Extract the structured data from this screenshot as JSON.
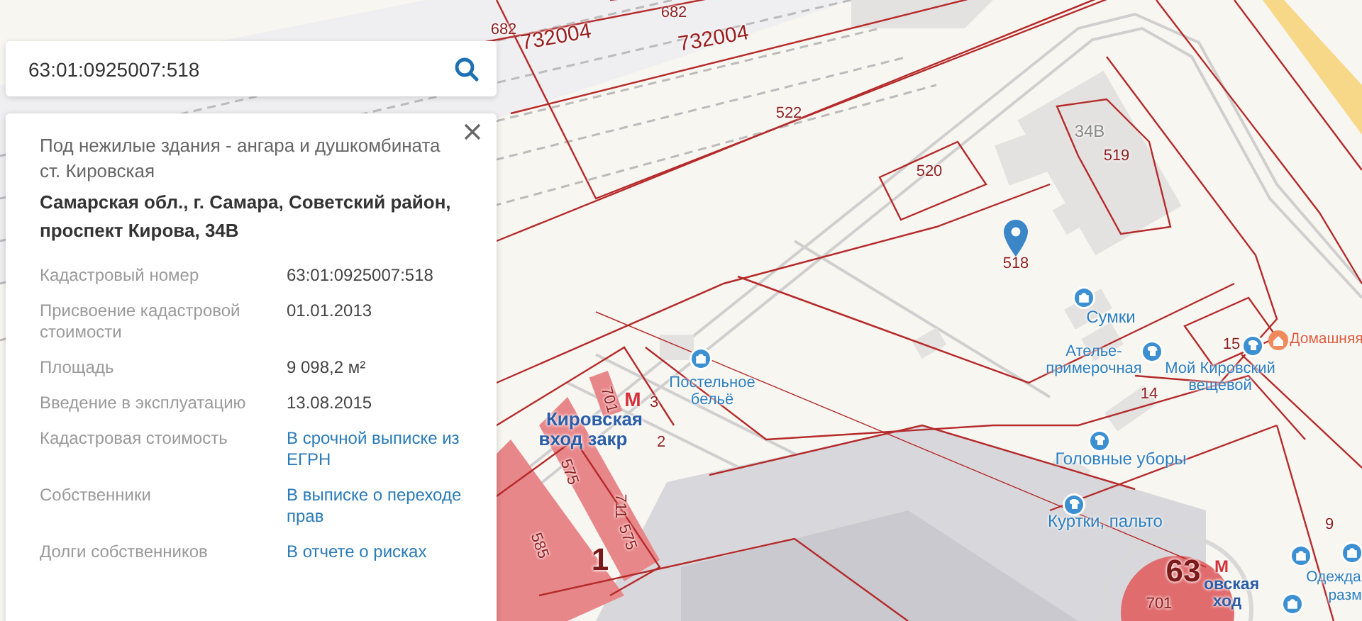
{
  "search": {
    "value": "63:01:0925007:518"
  },
  "card": {
    "description": "Под нежилые здания - ангара и душкомбината ст. Кировская",
    "address": "Самарская обл., г. Самара, Советский район, проспект Кирова, 34В",
    "fields": [
      {
        "label": "Кадастровый номер",
        "value": "63:01:0925007:518",
        "kind": "text"
      },
      {
        "label": "Присвоение кадастровой стоимости",
        "value": "01.01.2013",
        "kind": "text"
      },
      {
        "label": "Площадь",
        "value": "9 098,2 м²",
        "kind": "text"
      },
      {
        "label": "Введение в эксплуатацию",
        "value": "13.08.2015",
        "kind": "text"
      },
      {
        "label": "Кадастровая стоимость",
        "value": "В срочной выписке из ЕГРН",
        "kind": "link"
      },
      {
        "label": "Собственники",
        "value": "В выписке о переходе прав",
        "kind": "link"
      },
      {
        "label": "Долги собственников",
        "value": "В отчете о рисках",
        "kind": "link"
      }
    ]
  },
  "map": {
    "labels": [
      {
        "text": "682",
        "kind": "parcel"
      },
      {
        "text": "682",
        "kind": "parcel"
      },
      {
        "text": "732004",
        "kind": "quarter"
      },
      {
        "text": "732004",
        "kind": "quarter"
      },
      {
        "text": "522",
        "kind": "parcel"
      },
      {
        "text": "34В",
        "kind": "house"
      },
      {
        "text": "519",
        "kind": "parcel"
      },
      {
        "text": "520",
        "kind": "parcel"
      },
      {
        "text": "518",
        "kind": "parcel"
      },
      {
        "text": "Сумки",
        "kind": "poi"
      },
      {
        "text": "Домашняя",
        "kind": "shop"
      },
      {
        "text": "15",
        "kind": "parcel"
      },
      {
        "text": "Ателье-\nпримерочная",
        "kind": "poi"
      },
      {
        "text": "Мой Кировский\nвещевой",
        "kind": "poi"
      },
      {
        "text": "Постельное\nбельё",
        "kind": "poi"
      },
      {
        "text": "14",
        "kind": "parcel"
      },
      {
        "text": "701",
        "kind": "parcel"
      },
      {
        "text": "М",
        "kind": "metro_sign"
      },
      {
        "text": "3",
        "kind": "parcel"
      },
      {
        "text": "Кировская",
        "kind": "metro"
      },
      {
        "text": "вход закр",
        "kind": "metro"
      },
      {
        "text": "2",
        "kind": "parcel"
      },
      {
        "text": "Головные уборы",
        "kind": "poi"
      },
      {
        "text": "575",
        "kind": "parcel"
      },
      {
        "text": "711",
        "kind": "parcel"
      },
      {
        "text": "Куртки, пальто",
        "kind": "poi"
      },
      {
        "text": "9",
        "kind": "parcel"
      },
      {
        "text": "575",
        "kind": "parcel"
      },
      {
        "text": "585",
        "kind": "parcel"
      },
      {
        "text": "1",
        "kind": "block"
      },
      {
        "text": "63",
        "kind": "block"
      },
      {
        "text": "М",
        "kind": "metro_sign"
      },
      {
        "text": "Одежда",
        "kind": "poi"
      },
      {
        "text": "овская",
        "kind": "metro"
      },
      {
        "text": "разм",
        "kind": "poi"
      },
      {
        "text": "701",
        "kind": "parcel"
      },
      {
        "text": "ход",
        "kind": "metro"
      }
    ]
  }
}
